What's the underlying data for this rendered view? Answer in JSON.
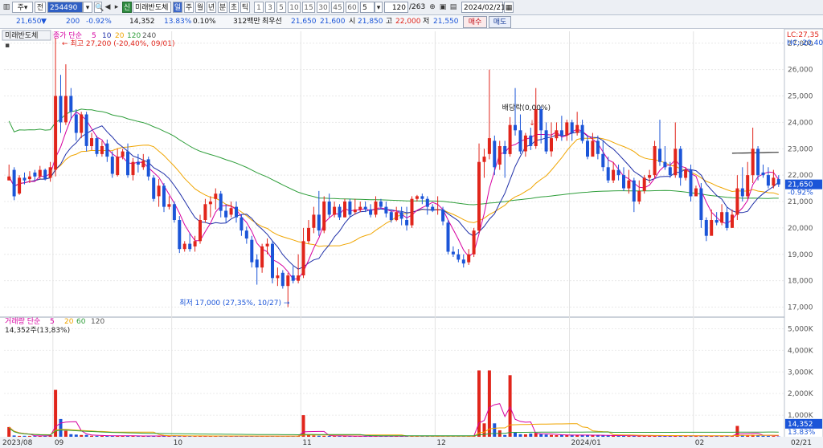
{
  "toolbar": {
    "code_value": "254490",
    "stock_name": "미래반도체",
    "badge": "신",
    "mode_label": "주",
    "jeon_label": "전",
    "periods": [
      "일",
      "주",
      "월",
      "년",
      "분",
      "초",
      "틱"
    ],
    "minutes": [
      "1",
      "3",
      "5",
      "10",
      "15",
      "30",
      "45",
      "60"
    ],
    "interval_value": "5",
    "count_value": "120",
    "count_total": "/263",
    "date_value": "2024/02/21",
    "icons": [
      "chart-type-icon",
      "arrow-left-icon",
      "arrow-right-icon",
      "zoom-icon",
      "lock-icon",
      "save-icon",
      "folder-icon",
      "calendar-icon"
    ]
  },
  "info": {
    "price": "21,650",
    "change_arrow": "▼",
    "change": "200",
    "change_pct": "-0.92%",
    "volume": "14,352",
    "vol_ratio": "13.83%",
    "turnover": "0.10%",
    "amount": "312백만",
    "best_ask_label": "최우선",
    "best_ask_sell": "21,650",
    "best_ask_buy": "21,600",
    "open_label": "시",
    "open": "21,850",
    "high_label": "고",
    "high": "22,000",
    "low_label": "저",
    "low": "21,550",
    "buy_btn": "매수",
    "sell_btn": "매도"
  },
  "chart_data": {
    "type": "candlestick",
    "title": "미래반도체",
    "legend_price": [
      "종가 단순",
      "5",
      "10",
      "20",
      "120",
      "240"
    ],
    "legend_volume": [
      "거래량 단순",
      "5",
      "20",
      "60",
      "120"
    ],
    "volume_note": "14,352주(13,83%)",
    "high_annotation": "최고 27,200 (-20,40%, 09/01)",
    "low_annotation": "최저 17,000 (27,35%, 10/27)",
    "dividend_annotation": "배당락(0,00%)",
    "lc_label": "LC:27,35",
    "hc_label": "HC:-20,40",
    "current_price_label": "21,650",
    "current_pct_label": "-0.92%",
    "current_volume_label": "14,352",
    "current_volume_pct_label": "13.83%",
    "y_ticks": [
      "27,000",
      "26,000",
      "25,000",
      "24,000",
      "23,000",
      "22,000",
      "21,000",
      "20,000",
      "19,000",
      "18,000",
      "17,000"
    ],
    "y_values": [
      27000,
      26000,
      25000,
      24000,
      23000,
      22000,
      21000,
      20000,
      19000,
      18000,
      17000
    ],
    "ylim": [
      16650,
      27450
    ],
    "vol_ticks": [
      "5,000K",
      "4,000K",
      "3,000K",
      "2,000K",
      "1,000K"
    ],
    "vol_values": [
      5000,
      4000,
      3000,
      2000,
      1000
    ],
    "vol_ylim": [
      0,
      5500
    ],
    "x_labels": [
      "2023/08",
      "09",
      "10",
      "11",
      "12",
      "2024/01",
      "02",
      "02/21"
    ],
    "x_label_idx": [
      0,
      9,
      32,
      57,
      83,
      109,
      133,
      160
    ],
    "candles": [
      [
        21800,
        21950,
        22400,
        21800,
        450
      ],
      [
        22200,
        21200,
        22300,
        21050,
        60
      ],
      [
        21300,
        21900,
        22000,
        21250,
        40
      ],
      [
        21900,
        21800,
        22100,
        21650,
        45
      ],
      [
        21850,
        21950,
        22150,
        21700,
        40
      ],
      [
        22100,
        21950,
        22200,
        21800,
        35
      ],
      [
        21950,
        22200,
        22350,
        21850,
        40
      ],
      [
        22200,
        21850,
        22250,
        21800,
        50
      ],
      [
        21900,
        22300,
        22500,
        21750,
        70
      ],
      [
        22200,
        25000,
        27200,
        21950,
        2170
      ],
      [
        25000,
        24000,
        25800,
        23600,
        820
      ],
      [
        24000,
        25000,
        26200,
        23900,
        280
      ],
      [
        25000,
        24400,
        25300,
        24100,
        120
      ],
      [
        24300,
        23600,
        24500,
        23300,
        100
      ],
      [
        23600,
        24300,
        24400,
        23400,
        80
      ],
      [
        24300,
        23100,
        24400,
        22900,
        85
      ],
      [
        23100,
        23400,
        23600,
        22950,
        50
      ],
      [
        23400,
        22800,
        23500,
        22700,
        45
      ],
      [
        22800,
        23100,
        23300,
        22700,
        45
      ],
      [
        23200,
        22700,
        23350,
        22500,
        40
      ],
      [
        22700,
        22050,
        22900,
        21900,
        40
      ],
      [
        22000,
        22700,
        23000,
        21950,
        50
      ],
      [
        22700,
        22900,
        23000,
        22600,
        45
      ],
      [
        22900,
        22000,
        23200,
        21900,
        40
      ],
      [
        22000,
        22500,
        22650,
        21800,
        45
      ],
      [
        22500,
        22400,
        22800,
        22100,
        30
      ],
      [
        22300,
        22550,
        22800,
        22200,
        30
      ],
      [
        22600,
        21950,
        22700,
        21800,
        35
      ],
      [
        21900,
        21100,
        22000,
        21000,
        55
      ],
      [
        21200,
        21600,
        21850,
        20800,
        45
      ],
      [
        21600,
        20800,
        21700,
        20600,
        40
      ],
      [
        20800,
        20900,
        21200,
        20700,
        35
      ],
      [
        20900,
        20300,
        21000,
        20200,
        40
      ],
      [
        20300,
        19200,
        20450,
        19050,
        45
      ],
      [
        19200,
        19400,
        19500,
        19100,
        30
      ],
      [
        19400,
        19200,
        19800,
        19100,
        30
      ],
      [
        19300,
        19500,
        19700,
        19100,
        35
      ],
      [
        19500,
        20300,
        20500,
        19400,
        40
      ],
      [
        20300,
        20900,
        21100,
        20200,
        35
      ],
      [
        20900,
        21000,
        21200,
        20400,
        30
      ],
      [
        21100,
        21300,
        21500,
        20700,
        30
      ],
      [
        21300,
        20650,
        21400,
        20400,
        35
      ],
      [
        20650,
        20400,
        20900,
        20200,
        30
      ],
      [
        20500,
        20750,
        21000,
        20400,
        30
      ],
      [
        20800,
        20400,
        21000,
        20200,
        30
      ],
      [
        20400,
        19900,
        20500,
        19700,
        30
      ],
      [
        19900,
        19600,
        20050,
        19400,
        30
      ],
      [
        19550,
        18700,
        19700,
        18500,
        35
      ],
      [
        18800,
        18500,
        19000,
        17850,
        30
      ],
      [
        18500,
        19300,
        19400,
        18300,
        30
      ],
      [
        19300,
        19400,
        19600,
        19000,
        30
      ],
      [
        19400,
        18100,
        19500,
        17900,
        30
      ],
      [
        18100,
        18200,
        18500,
        17800,
        30
      ],
      [
        18300,
        17800,
        18400,
        17700,
        30
      ],
      [
        17800,
        18200,
        18300,
        17000,
        35
      ],
      [
        18200,
        18000,
        18550,
        17900,
        30
      ],
      [
        18000,
        18200,
        19000,
        17900,
        40
      ],
      [
        18200,
        19500,
        20000,
        18100,
        1000
      ],
      [
        19500,
        20000,
        20300,
        19400,
        80
      ],
      [
        20000,
        20500,
        20800,
        19800,
        60
      ],
      [
        20500,
        19900,
        21400,
        19700,
        50
      ],
      [
        19900,
        21000,
        21200,
        19800,
        45
      ],
      [
        21000,
        20500,
        21300,
        20400,
        40
      ],
      [
        20500,
        20800,
        21000,
        20400,
        35
      ],
      [
        20800,
        20400,
        20900,
        20300,
        30
      ],
      [
        20400,
        21000,
        21100,
        20400,
        30
      ],
      [
        21000,
        20500,
        21100,
        20400,
        30
      ],
      [
        20600,
        20700,
        21100,
        20500,
        30
      ],
      [
        20700,
        20800,
        21000,
        20600,
        30
      ],
      [
        20800,
        20700,
        21000,
        20600,
        30
      ],
      [
        20700,
        20500,
        20900,
        20400,
        30
      ],
      [
        20500,
        21000,
        21200,
        20400,
        30
      ],
      [
        21000,
        20800,
        21100,
        20700,
        30
      ],
      [
        20800,
        20550,
        21000,
        20400,
        30
      ],
      [
        20600,
        20300,
        20700,
        20200,
        30
      ],
      [
        20300,
        20600,
        20800,
        20250,
        35
      ],
      [
        20600,
        20350,
        20800,
        20100,
        30
      ],
      [
        20300,
        20100,
        20800,
        19900,
        30
      ],
      [
        20100,
        21100,
        21200,
        20000,
        45
      ],
      [
        21100,
        21200,
        21250,
        21000,
        30
      ],
      [
        21200,
        21100,
        21300,
        20900,
        30
      ],
      [
        21100,
        20800,
        21200,
        20500,
        30
      ],
      [
        20800,
        20650,
        20900,
        20600,
        30
      ],
      [
        20700,
        20700,
        21200,
        20500,
        30
      ],
      [
        20700,
        20250,
        20800,
        20100,
        30
      ],
      [
        20200,
        19100,
        20300,
        19000,
        40
      ],
      [
        19100,
        19000,
        19300,
        18900,
        30
      ],
      [
        19000,
        18800,
        19200,
        18700,
        30
      ],
      [
        18800,
        18650,
        19000,
        18500,
        30
      ],
      [
        18700,
        19000,
        19200,
        18600,
        30
      ],
      [
        19000,
        19900,
        20000,
        18900,
        30
      ],
      [
        19900,
        22500,
        23200,
        19800,
        3070
      ],
      [
        22500,
        22700,
        23000,
        21900,
        620
      ],
      [
        22800,
        23400,
        26000,
        22600,
        3070
      ],
      [
        23300,
        22300,
        23500,
        22000,
        620
      ],
      [
        22400,
        23100,
        23300,
        22200,
        300
      ],
      [
        23100,
        22800,
        23300,
        21900,
        80
      ],
      [
        22800,
        23900,
        24200,
        22700,
        2850
      ],
      [
        23900,
        23700,
        25300,
        23500,
        200
      ],
      [
        23700,
        22900,
        24300,
        22800,
        120
      ],
      [
        22900,
        23500,
        23600,
        22700,
        110
      ],
      [
        23500,
        23100,
        23800,
        22950,
        150
      ],
      [
        23100,
        24500,
        25300,
        23000,
        180
      ],
      [
        24500,
        23700,
        24600,
        23200,
        120
      ],
      [
        23700,
        22900,
        24000,
        22800,
        100
      ],
      [
        22900,
        23400,
        24000,
        22700,
        80
      ],
      [
        23400,
        23700,
        24000,
        23300,
        75
      ],
      [
        23700,
        23500,
        24250,
        23300,
        90
      ],
      [
        23500,
        24000,
        24100,
        23300,
        80
      ],
      [
        24000,
        23600,
        24100,
        23300,
        70
      ],
      [
        23600,
        23900,
        24400,
        23500,
        75
      ],
      [
        23900,
        23300,
        24100,
        23200,
        80
      ],
      [
        23300,
        22700,
        23500,
        22600,
        80
      ],
      [
        22700,
        23300,
        23600,
        22800,
        70
      ],
      [
        23300,
        22800,
        23500,
        22600,
        65
      ],
      [
        22800,
        22300,
        23300,
        22150,
        60
      ],
      [
        22300,
        21800,
        22700,
        21700,
        55
      ],
      [
        21800,
        22200,
        22500,
        21700,
        55
      ],
      [
        22200,
        22000,
        22400,
        21800,
        50
      ],
      [
        22000,
        21500,
        22300,
        21400,
        50
      ],
      [
        21500,
        21800,
        22200,
        21300,
        45
      ],
      [
        21800,
        21000,
        21900,
        20600,
        45
      ],
      [
        21000,
        21400,
        21800,
        20900,
        45
      ],
      [
        21400,
        21900,
        22000,
        21300,
        40
      ],
      [
        21900,
        22000,
        22200,
        21700,
        45
      ],
      [
        22000,
        23100,
        23300,
        21900,
        45
      ],
      [
        23000,
        22500,
        24100,
        22350,
        40
      ],
      [
        22500,
        22300,
        23100,
        22200,
        40
      ],
      [
        22300,
        22000,
        22500,
        21900,
        40
      ],
      [
        22000,
        23000,
        24000,
        21900,
        70
      ],
      [
        23000,
        21900,
        23100,
        21600,
        45
      ],
      [
        21900,
        22200,
        22300,
        21800,
        35
      ],
      [
        22200,
        21200,
        22400,
        21000,
        40
      ],
      [
        21200,
        21500,
        21600,
        21200,
        35
      ],
      [
        21500,
        20300,
        21700,
        20000,
        50
      ],
      [
        20300,
        19700,
        20400,
        19500,
        40
      ],
      [
        19700,
        20300,
        20700,
        19800,
        45
      ],
      [
        20300,
        20200,
        20600,
        20100,
        35
      ],
      [
        20200,
        20600,
        20900,
        20100,
        35
      ],
      [
        20600,
        20000,
        20800,
        19900,
        45
      ],
      [
        20000,
        20500,
        20700,
        20000,
        35
      ],
      [
        20500,
        21500,
        22000,
        20300,
        500
      ],
      [
        21500,
        21200,
        22300,
        21000,
        60
      ],
      [
        21200,
        22000,
        22500,
        21100,
        70
      ],
      [
        22000,
        23000,
        23800,
        21700,
        90
      ],
      [
        23000,
        22000,
        23100,
        21800,
        80
      ],
      [
        22100,
        22000,
        22400,
        21900,
        50
      ],
      [
        22000,
        21600,
        22300,
        21500,
        40
      ],
      [
        21600,
        21900,
        22200,
        21500,
        35
      ],
      [
        21850,
        21650,
        22000,
        21550,
        14
      ]
    ]
  },
  "colors": {
    "up": "#e1251b",
    "down": "#1b55d8",
    "ma5": "#d600a0",
    "ma10": "#1f2fa8",
    "ma20": "#f0a500",
    "ma120": "#2e9e3a",
    "ma240": "#333333"
  }
}
